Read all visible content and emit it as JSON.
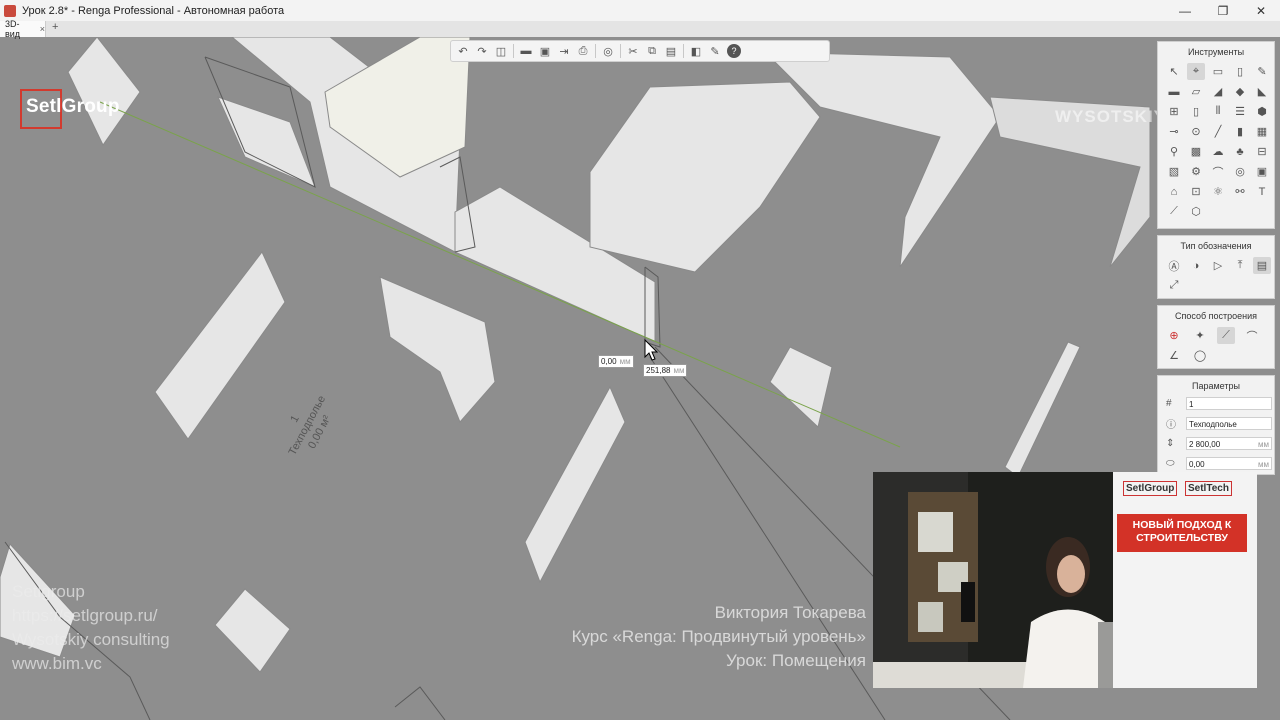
{
  "window": {
    "title": "Урок 2.8* - Renga Professional - Автономная работа",
    "controls": [
      "—",
      "❐",
      "✕"
    ]
  },
  "tabs": [
    {
      "label": "3D-вид",
      "close": "×"
    }
  ],
  "tab_add": "+",
  "watermark": {
    "logo": "SetlGroup",
    "brand": "WYSOTSKIY",
    "left_lines": [
      "Setlgroup",
      "https://setlgroup.ru/",
      "Wysotskiy consulting",
      "www.bim.vc"
    ],
    "right_lines": [
      "Виктория Токарева",
      "Курс «Renga: Продвинутый уровень»",
      "Урок: Помещения"
    ]
  },
  "room_label": {
    "number": "1",
    "name": "Техподполье",
    "area": "0,00 м²"
  },
  "dimensions": [
    {
      "value": "0,00",
      "unit": "мм"
    },
    {
      "value": "251,88",
      "unit": "мм"
    }
  ],
  "panels": {
    "tools_title": "Инструменты",
    "designation_title": "Тип обозначения",
    "method_title": "Способ построения",
    "params_title": "Параметры",
    "params": [
      {
        "value": "1",
        "unit": ""
      },
      {
        "value": "Техподполье",
        "unit": ""
      },
      {
        "value": "2 800,00",
        "unit": "мм"
      },
      {
        "value": "0,00",
        "unit": "мм"
      }
    ]
  },
  "webcam": {
    "logo1": "SetlGroup",
    "logo2": "SetlTech",
    "banner_text": "НОВЫЙ ПОДХОД К СТРОИТЕЛЬСТВУ"
  }
}
